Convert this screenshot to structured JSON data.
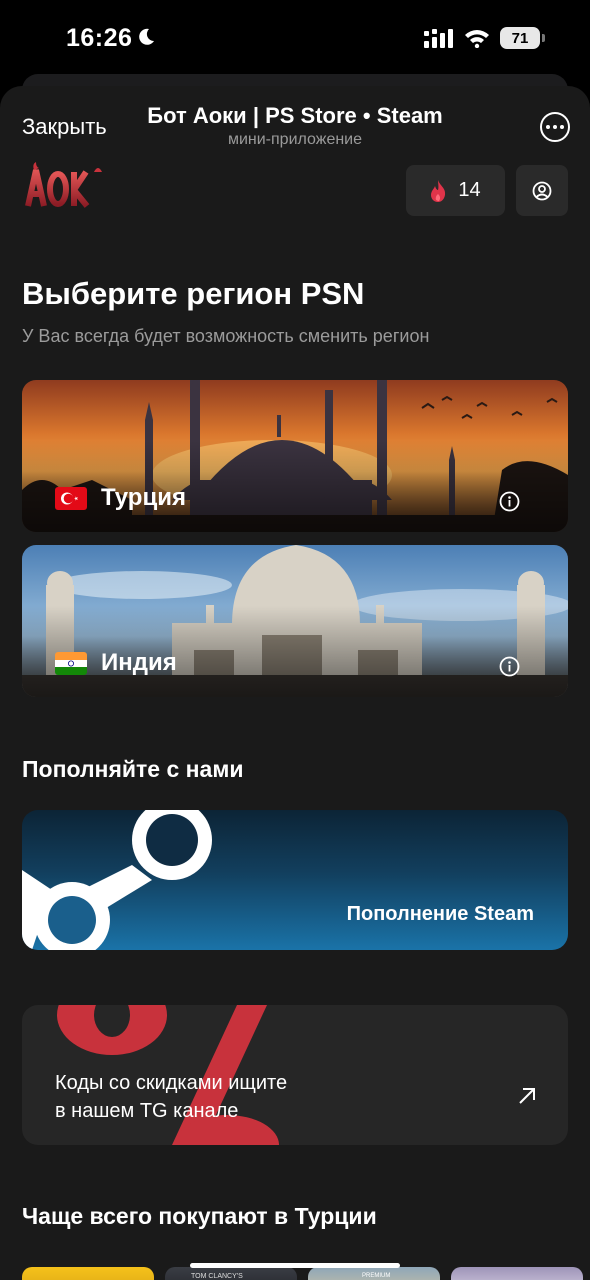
{
  "status_bar": {
    "time": "16:26",
    "battery": "71"
  },
  "header": {
    "close_label": "Закрыть",
    "title": "Бот Аоки | PS Store • Steam",
    "subtitle": "мини-приложение"
  },
  "top_bar": {
    "logo_text": "AOKI",
    "fire_count": "14"
  },
  "region_section": {
    "title": "Выберите регион PSN",
    "subtitle": "У Вас всегда будет возможность сменить регион",
    "regions": [
      {
        "label": "Турция",
        "flag": "turkey-flag"
      },
      {
        "label": "Индия",
        "flag": "india-flag"
      }
    ]
  },
  "topup_section": {
    "title": "Пополняйте с нами",
    "steam_label": "Пополнение Steam",
    "codes_line1": "Коды со скидками ищите",
    "codes_line2": "в нашем TG канале"
  },
  "popular_section": {
    "title": "Чаще всего покупают в Турции",
    "thumb_captions": [
      "TOM CLANCY'S",
      "PREMIUM"
    ]
  },
  "colors": {
    "background": "#1a1a1a",
    "card": "#262626",
    "button_bg": "#2a2a2a",
    "accent_red": "#c8323c",
    "steam_blue": "#1a73a8"
  }
}
